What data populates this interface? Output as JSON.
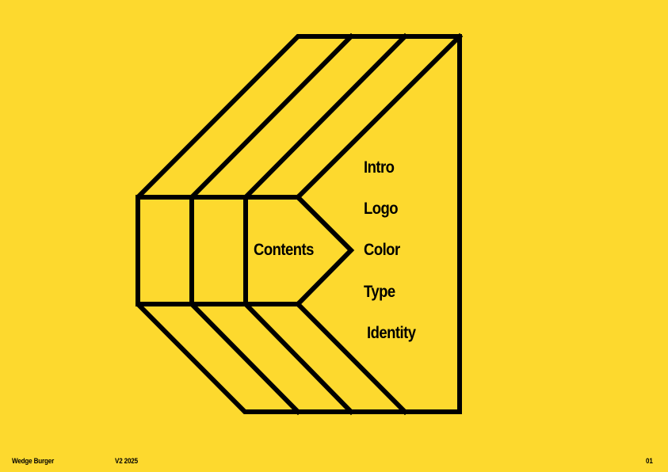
{
  "colors": {
    "background": "#fdd92e",
    "ink": "#000000"
  },
  "contents": {
    "title": "Contents",
    "items": [
      {
        "label": "Intro"
      },
      {
        "label": "Logo"
      },
      {
        "label": "Color"
      },
      {
        "label": "Type"
      },
      {
        "label": "Identity"
      }
    ]
  },
  "footer": {
    "brand": "Wedge Burger",
    "version": "V2 2025",
    "page_number": "01"
  }
}
